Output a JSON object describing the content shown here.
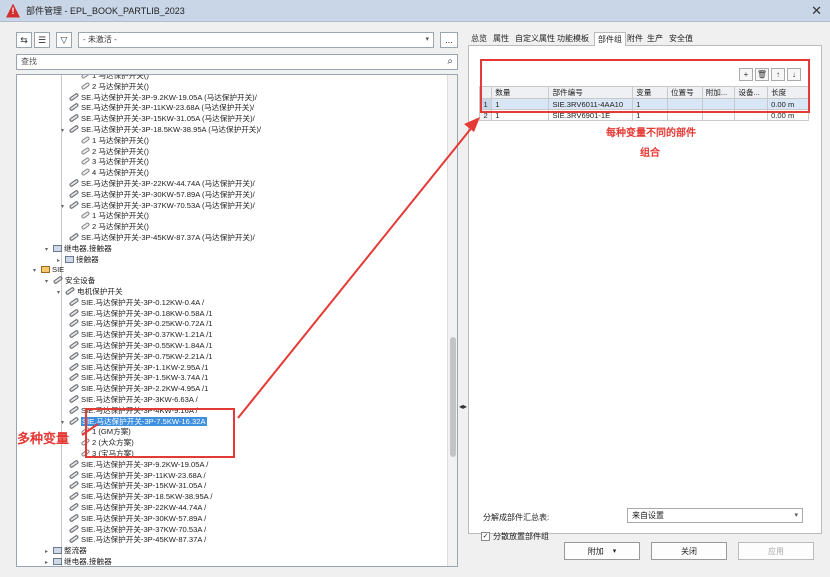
{
  "window": {
    "title": "部件管理 - EPL_BOOK_PARTLIB_2023",
    "close_glyph": "✕",
    "app_icon_glyph": "!"
  },
  "left": {
    "filter_value": "- 未激活 -",
    "more_label": "...",
    "search_placeholder": "查找",
    "tree": [
      {
        "t": "1 马达保护开关()",
        "icon": "sub"
      },
      {
        "t": "2 马达保护开关()",
        "icon": "sub"
      },
      {
        "t": "SE.马达保护开关-3P-9.2KW-19.05A (马达保护开关)/",
        "icon": "part"
      },
      {
        "t": "SE.马达保护开关-3P-11KW-23.68A (马达保护开关)/",
        "icon": "part"
      },
      {
        "t": "SE.马达保护开关-3P-15KW-31.05A (马达保护开关)/",
        "icon": "part"
      },
      {
        "t": "SE.马达保护开关-3P-18.5KW-38.95A (马达保护开关)/",
        "icon": "part"
      },
      {
        "t": "1 马达保护开关()",
        "icon": "sub"
      },
      {
        "t": "2 马达保护开关()",
        "icon": "sub"
      },
      {
        "t": "3 马达保护开关()",
        "icon": "sub"
      },
      {
        "t": "4 马达保护开关()",
        "icon": "sub"
      },
      {
        "t": "SE.马达保护开关-3P-22KW-44.74A (马达保护开关)/",
        "icon": "part"
      },
      {
        "t": "SE.马达保护开关-3P-30KW-57.89A (马达保护开关)/",
        "icon": "part"
      },
      {
        "t": "SE.马达保护开关-3P-37KW-70.53A (马达保护开关)/",
        "icon": "part"
      },
      {
        "t": "1 马达保护开关()",
        "icon": "sub"
      },
      {
        "t": "2 马达保护开关()",
        "icon": "sub"
      },
      {
        "t": "SE.马达保护开关-3P-45KW-87.37A (马达保护开关)/",
        "icon": "part"
      },
      {
        "t": "继电器,接触器",
        "icon": "group"
      },
      {
        "t": "接触器",
        "icon": "group"
      },
      {
        "t": "SIE",
        "icon": "folder"
      },
      {
        "t": "安全设备",
        "icon": "part"
      },
      {
        "t": "电机保护开关",
        "icon": "part"
      },
      {
        "t": "SIE.马达保护开关-3P-0.12KW-0.4A /",
        "icon": "part"
      },
      {
        "t": "SIE.马达保护开关-3P-0.18KW-0.58A /1",
        "icon": "part"
      },
      {
        "t": "SIE.马达保护开关-3P-0.25KW-0.72A /1",
        "icon": "part"
      },
      {
        "t": "SIE.马达保护开关-3P-0.37KW-1.21A /1",
        "icon": "part"
      },
      {
        "t": "SIE.马达保护开关-3P-0.55KW-1.84A /1",
        "icon": "part"
      },
      {
        "t": "SIE.马达保护开关-3P-0.75KW-2.21A /1",
        "icon": "part"
      },
      {
        "t": "SIE.马达保护开关-3P-1.1KW-2.95A /1",
        "icon": "part"
      },
      {
        "t": "SIE.马达保护开关-3P-1.5KW-3.74A /1",
        "icon": "part"
      },
      {
        "t": "SIE.马达保护开关-3P-2.2KW-4.95A /1",
        "icon": "part"
      },
      {
        "t": "SIE.马达保护开关-3P-3KW-6.63A /",
        "icon": "part"
      },
      {
        "t": "SIE.马达保护开关-3P-4KW-9.16A /",
        "icon": "part"
      },
      {
        "t": "SIE.马达保护开关-3P-7.5KW-16.32A",
        "icon": "part",
        "sel": true
      },
      {
        "t": "1 (GM方案)",
        "icon": "sub"
      },
      {
        "t": "2 (大众方案)",
        "icon": "sub"
      },
      {
        "t": "3 (宝马方案)",
        "icon": "sub"
      },
      {
        "t": "SIE.马达保护开关-3P-9.2KW-19.05A /",
        "icon": "part"
      },
      {
        "t": "SIE.马达保护开关-3P-11KW-23.68A /",
        "icon": "part"
      },
      {
        "t": "SIE.马达保护开关-3P-15KW-31.05A /",
        "icon": "part"
      },
      {
        "t": "SIE.马达保护开关-3P-18.5KW-38.95A /",
        "icon": "part"
      },
      {
        "t": "SIE.马达保护开关-3P-22KW-44.74A /",
        "icon": "part"
      },
      {
        "t": "SIE.马达保护开关-3P-30KW-57.89A /",
        "icon": "part"
      },
      {
        "t": "SIE.马达保护开关-3P-37KW-70.53A /",
        "icon": "part"
      },
      {
        "t": "SIE.马达保护开关-3P-45KW-87.37A /",
        "icon": "part"
      },
      {
        "t": "整流器",
        "icon": "group"
      },
      {
        "t": "继电器,接触器",
        "icon": "group"
      }
    ]
  },
  "right": {
    "tabs": [
      "总览",
      "属性",
      "自定义属性",
      "功能模板",
      "部件组",
      "附件",
      "生产",
      "安全值"
    ],
    "active_tab": "部件组",
    "grid_headers": [
      "数量",
      "部件编号",
      "变量",
      "位置号",
      "附加...",
      "设备...",
      "长度"
    ],
    "grid_rows": [
      [
        "1",
        "1",
        "SIE.3RV6011-4AA10",
        "1",
        "",
        "",
        "",
        "0.00 m"
      ],
      [
        "2",
        "1",
        "SIE.3RV6901-1E",
        "1",
        "",
        "",
        "",
        "0.00 m"
      ]
    ],
    "resolve_label": "分解成部件汇总表:",
    "resolve_value": "来自设置",
    "scatter_label": "分散放置部件组",
    "scatter_checked": "✓"
  },
  "buttons": {
    "extra": "附加",
    "close": "关闭",
    "apply": "应用"
  },
  "annotations": {
    "left": "多种变量",
    "right_line1": "每种变量不同的部件",
    "right_line2": "组合"
  },
  "colors": {
    "annotation_red": "#e53935",
    "selection_blue": "#3d8fe0"
  }
}
